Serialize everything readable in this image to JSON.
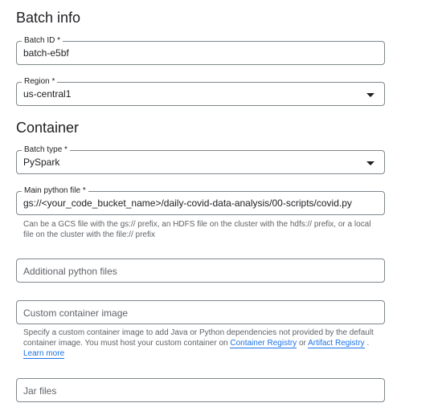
{
  "batch_info": {
    "title": "Batch info",
    "batch_id": {
      "label": "Batch ID *",
      "value": "batch-e5bf"
    },
    "region": {
      "label": "Region *",
      "value": "us-central1",
      "icon": "chevron-down-icon"
    }
  },
  "container": {
    "title": "Container",
    "batch_type": {
      "label": "Batch type *",
      "value": "PySpark",
      "icon": "chevron-down-icon"
    },
    "main_python_file": {
      "label": "Main python file *",
      "value": "gs://<your_code_bucket_name>/daily-covid-data-analysis/00-scripts/covid.py",
      "hint": "Can be a GCS file with the gs:// prefix, an HDFS file on the cluster with the hdfs:// prefix, or a local file on the cluster with the file:// prefix"
    },
    "additional_python_files": {
      "placeholder": "Additional python files"
    },
    "custom_container_image": {
      "placeholder": "Custom container image",
      "hint_prefix": "Specify a custom container image to add Java or Python dependencies not provided by the default container image. You must host your custom container on ",
      "link_container_registry": "Container Registry",
      "hint_or": " or ",
      "link_artifact_registry": "Artifact Registry",
      "hint_sep": " . ",
      "link_learn_more": "Learn more"
    },
    "jar_files": {
      "placeholder": "Jar files"
    }
  },
  "colors": {
    "link": "#1a73e8",
    "text": "#202124",
    "secondary_text": "#5f6368",
    "border": "#80868b"
  }
}
